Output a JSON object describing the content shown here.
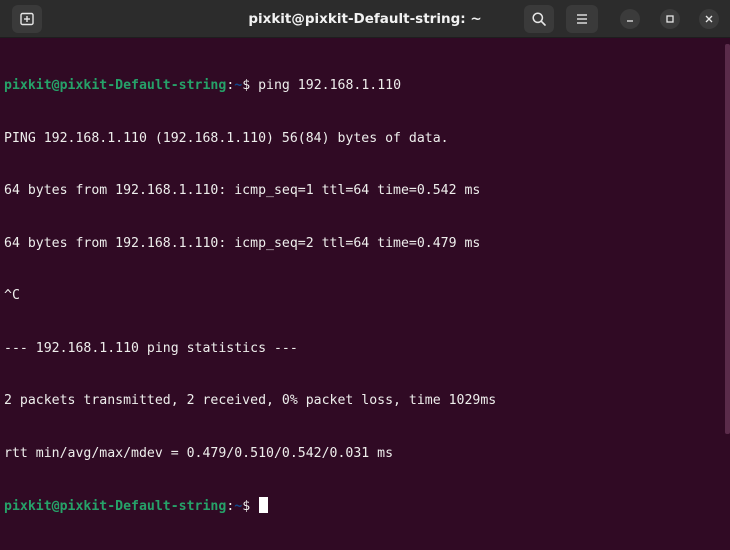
{
  "window": {
    "title": "pixkit@pixkit-Default-string: ~"
  },
  "icons": {
    "new_tab": "new-tab-icon",
    "search": "search-icon",
    "menu": "hamburger-menu-icon",
    "minimize": "minimize-icon",
    "maximize": "maximize-icon",
    "close": "close-icon"
  },
  "colors": {
    "background": "#300a24",
    "prompt_user": "#26a269",
    "prompt_path": "#12488b",
    "text": "#eeeeec"
  },
  "terminal": {
    "prompt1": {
      "user_host": "pixkit@pixkit-Default-string",
      "colon": ":",
      "path": "~",
      "symbol": "$",
      "command": " ping 192.168.1.110"
    },
    "output": [
      "PING 192.168.1.110 (192.168.1.110) 56(84) bytes of data.",
      "64 bytes from 192.168.1.110: icmp_seq=1 ttl=64 time=0.542 ms",
      "64 bytes from 192.168.1.110: icmp_seq=2 ttl=64 time=0.479 ms",
      "^C",
      "--- 192.168.1.110 ping statistics ---",
      "2 packets transmitted, 2 received, 0% packet loss, time 1029ms",
      "rtt min/avg/max/mdev = 0.479/0.510/0.542/0.031 ms"
    ],
    "prompt2": {
      "user_host": "pixkit@pixkit-Default-string",
      "colon": ":",
      "path": "~",
      "symbol": "$ "
    }
  }
}
